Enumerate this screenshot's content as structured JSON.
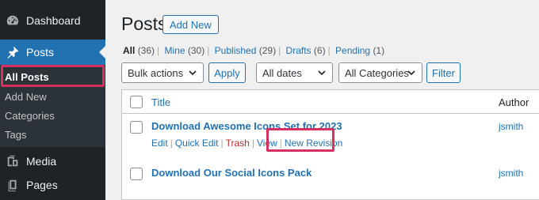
{
  "sidebar": {
    "dashboard": "Dashboard",
    "posts": "Posts",
    "submenu": [
      "All Posts",
      "Add New",
      "Categories",
      "Tags"
    ],
    "media": "Media",
    "pages": "Pages",
    "icons": {
      "dashboard": "dashboard-gauge-icon",
      "posts": "thumbtack-pin-icon",
      "media": "media-camera-icon",
      "pages": "pages-document-icon"
    }
  },
  "header": {
    "title": "Posts",
    "add_new": "Add New"
  },
  "filters": {
    "views": [
      {
        "label": "All",
        "count": "(36)",
        "current": true
      },
      {
        "label": "Mine",
        "count": "(30)"
      },
      {
        "label": "Published",
        "count": "(29)"
      },
      {
        "label": "Drafts",
        "count": "(6)"
      },
      {
        "label": "Pending",
        "count": "(1)"
      }
    ],
    "bulk_actions": "Bulk actions",
    "apply": "Apply",
    "dates": "All dates",
    "categories": "All Categories",
    "filter": "Filter"
  },
  "table": {
    "columns": {
      "title": "Title",
      "author": "Author"
    },
    "rows": [
      {
        "title": "Download Awesome Icons Set for 2023",
        "author": "jsmith",
        "actions": [
          "Edit",
          "Quick Edit",
          "Trash",
          "View",
          "New Revision"
        ]
      },
      {
        "title": "Download Our Social Icons Pack",
        "author": "jsmith"
      }
    ]
  },
  "colors": {
    "highlight": "#d63163",
    "accent": "#2271b1",
    "sidebar_bg": "#1d2327"
  }
}
